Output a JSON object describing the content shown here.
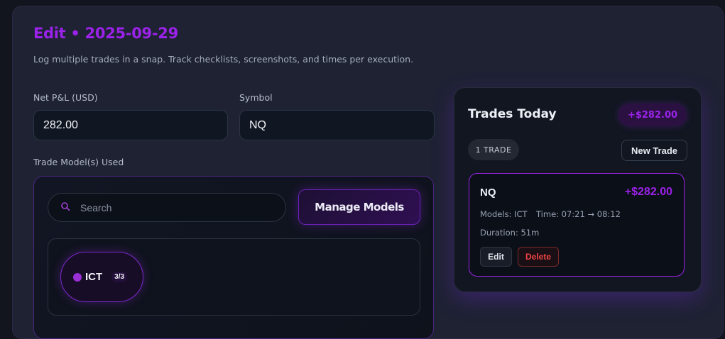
{
  "header": {
    "title": "Edit • 2025-09-29",
    "subtitle": "Log multiple trades in a snap. Track checklists, screenshots, and times per execution."
  },
  "form": {
    "pnl_label": "Net P&L (USD)",
    "pnl_value": "282.00",
    "symbol_label": "Symbol",
    "symbol_value": "NQ",
    "models_label": "Trade Model(s) Used",
    "search_placeholder": "Search",
    "manage_label": "Manage Models",
    "models": [
      {
        "name": "ICT",
        "count": "3/3",
        "color": "#9a2fd6"
      }
    ]
  },
  "sidebar": {
    "title": "Trades Today",
    "total": "+$282.00",
    "count": "1 TRADE",
    "new_label": "New Trade",
    "trades": [
      {
        "symbol": "NQ",
        "pnl": "+$282.00",
        "models": "Models: ICT",
        "time": "Time: 07:21 → 08:12",
        "duration": "Duration: 51m",
        "edit_label": "Edit",
        "delete_label": "Delete"
      }
    ]
  },
  "colors": {
    "accent": "#9b22e8",
    "danger": "#f04444"
  }
}
